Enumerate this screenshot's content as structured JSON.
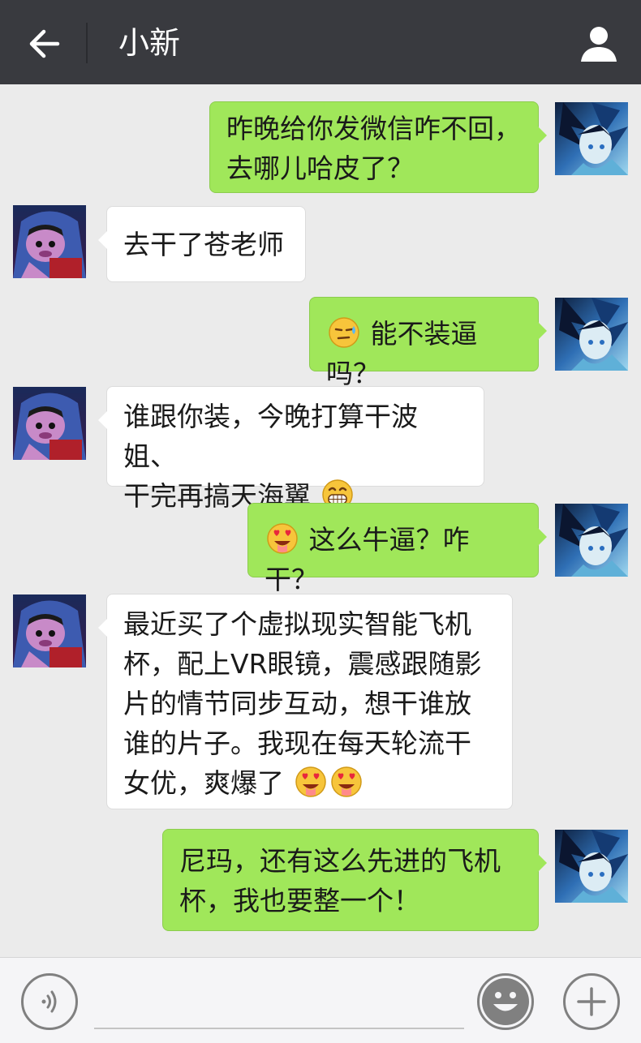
{
  "header": {
    "title": "小新",
    "back_icon": "back-arrow-icon",
    "profile_icon": "person-icon"
  },
  "colors": {
    "header_bg": "#393a3f",
    "chat_bg": "#ebebeb",
    "my_bubble": "#a0e75a",
    "their_bubble": "#ffffff"
  },
  "messages": [
    {
      "sender": "me",
      "text": "昨晚给你发微信咋不回，\n去哪儿哈皮了？"
    },
    {
      "sender": "friend",
      "text": "去干了苍老师"
    },
    {
      "sender": "me",
      "emoji_before": "sweat-emoji",
      "text": "能不装逼吗？"
    },
    {
      "sender": "friend",
      "text": "谁跟你装，今晚打算干波姐、\n干完再搞天海翼",
      "emoji_after": "grin-emoji"
    },
    {
      "sender": "me",
      "emoji_before": "heart-eyes-emoji",
      "text": "这么牛逼？咋干？"
    },
    {
      "sender": "friend",
      "text": "最近买了个虚拟现实智能飞机\n杯，配上VR眼镜，震感跟随影\n片的情节同步互动，想干谁放\n谁的片子。我现在每天轮流干\n女优，爽爆了",
      "emoji_after": "heart-eyes-emoji",
      "emoji_after_count": 2
    },
    {
      "sender": "me",
      "text": "尼玛，还有这么先进的飞机\n杯，我也要整一个！"
    }
  ],
  "footer": {
    "voice_icon": "voice-icon",
    "emoji_icon": "smiley-icon",
    "plus_icon": "plus-icon"
  }
}
